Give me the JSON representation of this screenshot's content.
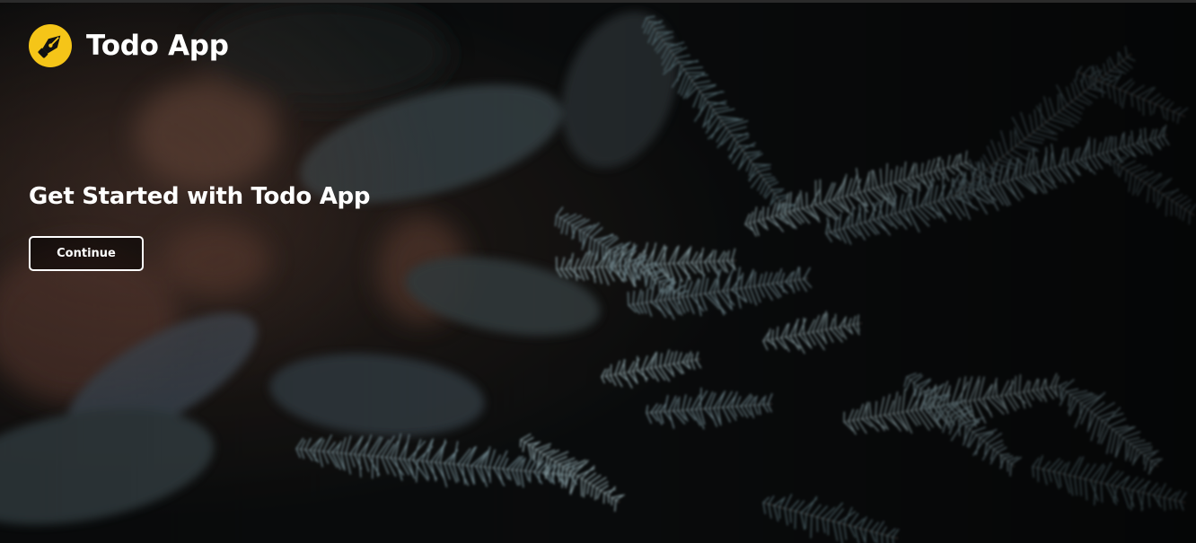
{
  "brand": {
    "name": "Todo App",
    "logo_icon": "fountain-pen-nib-icon",
    "logo_color": "#f5c518"
  },
  "hero": {
    "title": "Get Started with Todo App",
    "continue_label": "Continue",
    "background_image": "blue-spruce-branches-photo"
  },
  "colors": {
    "accent": "#f5c518",
    "text": "#ffffff",
    "background": "#0b0d0e"
  }
}
